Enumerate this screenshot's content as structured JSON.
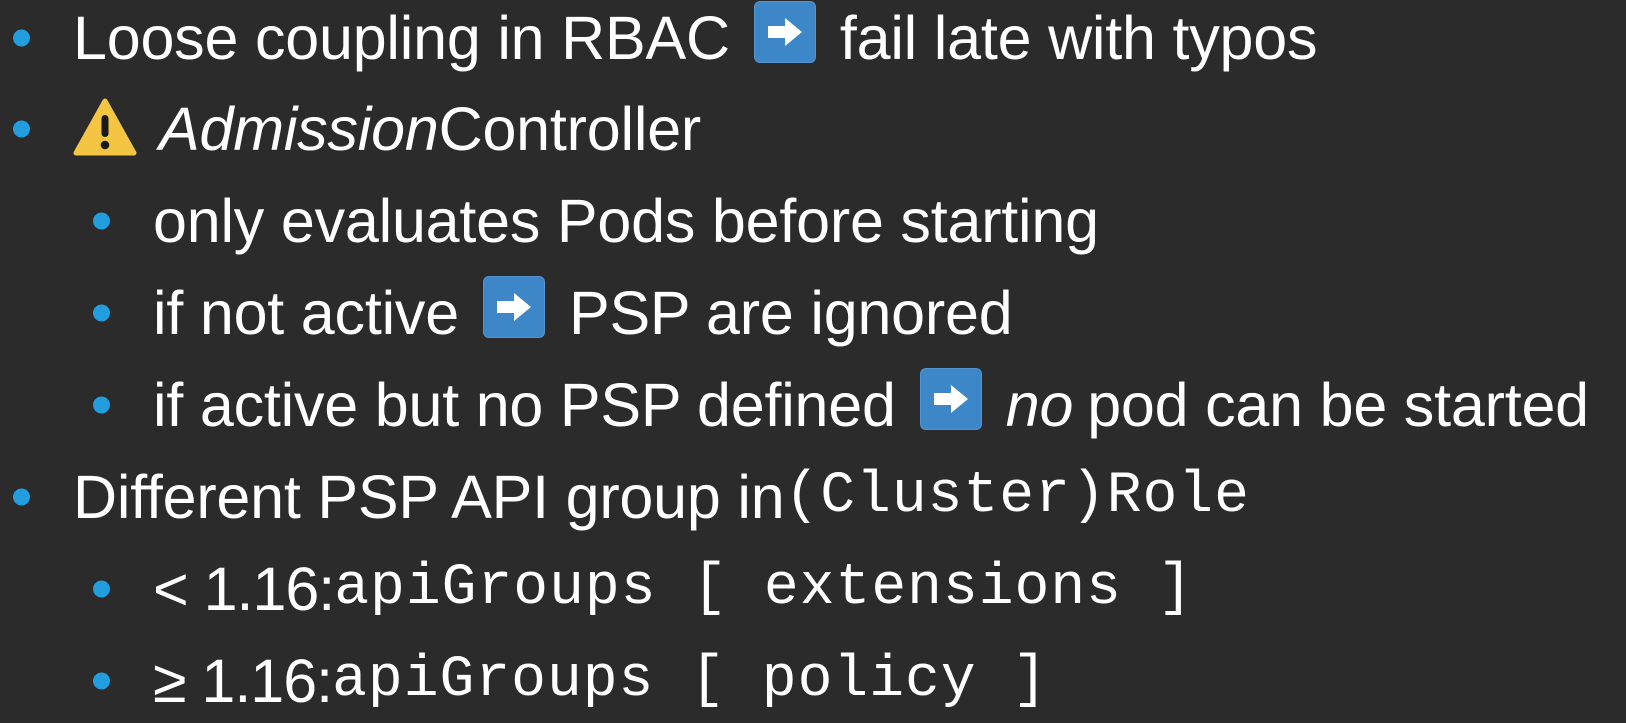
{
  "bullets": [
    {
      "text_before": "Loose coupling in RBAC",
      "icon": "right-arrow-icon",
      "text_after": "fail late with typos"
    },
    {
      "icon": "warning-icon",
      "italic": "Admission",
      "text": "Controller"
    },
    {
      "text": "only evaluates Pods before starting"
    },
    {
      "text_before": "if not active",
      "icon": "right-arrow-icon",
      "text_after": "PSP are ignored"
    },
    {
      "text_before": "if active but no PSP defined",
      "icon": "right-arrow-icon",
      "italic": "no",
      "text_after": " pod can be started"
    },
    {
      "text": "Different PSP API group in ",
      "code": "(Cluster)Role"
    },
    {
      "prefix": "< 1.16: ",
      "code": "apiGroups [ extensions ]"
    },
    {
      "prefix": "≥ 1.16: ",
      "code": "apiGroups [ policy ]"
    }
  ],
  "colors": {
    "background": "#2b2b2b",
    "bullet": "#229ddd",
    "icon_blue": "#3d86c8",
    "warning": "#f4c542",
    "text": "#ffffff"
  }
}
